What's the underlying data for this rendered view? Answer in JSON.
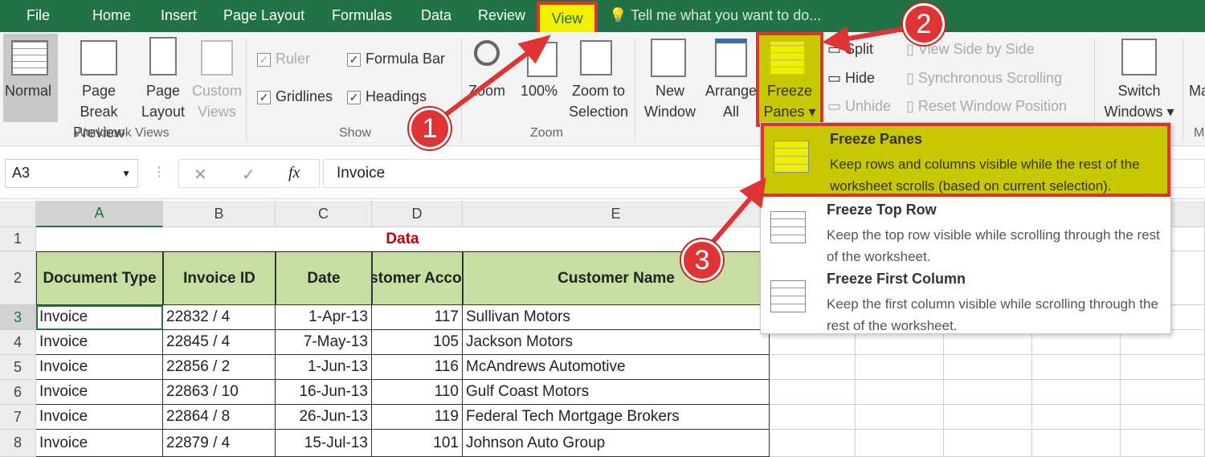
{
  "tabs": [
    "File",
    "Home",
    "Insert",
    "Page Layout",
    "Formulas",
    "Data",
    "Review",
    "View"
  ],
  "tell_me": "Tell me what you want to do...",
  "ribbon": {
    "workbook_views": {
      "normal": "Normal",
      "page_break": [
        "Page Break",
        "Preview"
      ],
      "page_layout": [
        "Page",
        "Layout"
      ],
      "custom_views": [
        "Custom",
        "Views"
      ],
      "label": "Workbook Views"
    },
    "show": {
      "ruler": "Ruler",
      "formula_bar": "Formula Bar",
      "gridlines": "Gridlines",
      "headings": "Headings",
      "label": "Show"
    },
    "zoom": {
      "zoom": "Zoom",
      "hundred": "100%",
      "zoom_to_selection": [
        "Zoom to",
        "Selection"
      ],
      "label": "Zoom"
    },
    "window": {
      "new_window": [
        "New",
        "Window"
      ],
      "arrange_all": [
        "Arrange",
        "All"
      ],
      "freeze_panes": [
        "Freeze",
        "Panes ▾"
      ],
      "split": "Split",
      "hide": "Hide",
      "unhide": "Unhide",
      "view_side": "View Side by Side",
      "sync_scroll": "Synchronous Scrolling",
      "reset_pos": "Reset Window Position",
      "switch_windows": [
        "Switch",
        "Windows ▾"
      ],
      "macros": "Ma",
      "macros_group": "M"
    }
  },
  "formula_bar": {
    "name_box": "A3",
    "fx": "fx",
    "cancel": "✕",
    "enter": "✓",
    "value": "Invoice"
  },
  "columns": [
    "A",
    "B",
    "C",
    "D",
    "E"
  ],
  "row_numbers": [
    "1",
    "2",
    "3",
    "4",
    "5",
    "6",
    "7",
    "8"
  ],
  "title_row": "Data",
  "headers": [
    "Document Type",
    "Invoice ID",
    "Date",
    "Customer Account",
    "Customer Name"
  ],
  "rows": [
    [
      "Invoice",
      "22832 / 4",
      "1-Apr-13",
      "117",
      "Sullivan Motors"
    ],
    [
      "Invoice",
      "22845 / 4",
      "7-May-13",
      "105",
      "Jackson Motors"
    ],
    [
      "Invoice",
      "22856 / 2",
      "1-Jun-13",
      "116",
      "McAndrews Automotive"
    ],
    [
      "Invoice",
      "22863 / 10",
      "16-Jun-13",
      "110",
      "Gulf Coast Motors"
    ],
    [
      "Invoice",
      "22864 / 8",
      "26-Jun-13",
      "119",
      "Federal Tech Mortgage Brokers"
    ],
    [
      "Invoice",
      "22879 / 4",
      "15-Jul-13",
      "101",
      "Johnson Auto Group"
    ]
  ],
  "menu": [
    {
      "title": "Freeze Panes",
      "desc": "Keep rows and columns visible while the rest of the worksheet scrolls (based on current selection)."
    },
    {
      "title": "Freeze Top Row",
      "desc": "Keep the top row visible while scrolling through the rest of the worksheet."
    },
    {
      "title": "Freeze First Column",
      "desc": "Keep the first column visible while scrolling through the rest of the worksheet."
    }
  ],
  "steps": [
    "1",
    "2",
    "3"
  ],
  "colors": {
    "excel_green": "#217346",
    "highlight": "#c8c800",
    "annotation_red": "#e03333",
    "header_fill": "#c6dea2",
    "title_red": "#c00000"
  }
}
